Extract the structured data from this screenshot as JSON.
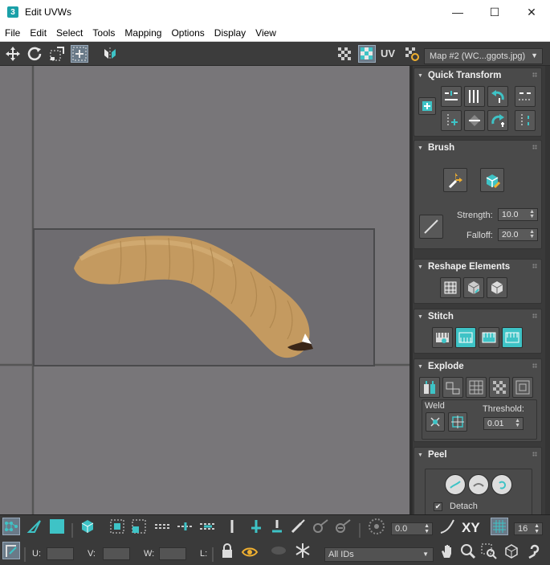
{
  "window": {
    "title": "Edit UVWs",
    "app_icon_glyph": "3",
    "minimize": "—",
    "maximize": "☐",
    "close": "✕"
  },
  "menu": [
    "File",
    "Edit",
    "Select",
    "Tools",
    "Mapping",
    "Options",
    "Display",
    "View"
  ],
  "toolbar": {
    "uv_label": "UV",
    "map_selector": "Map #2 (WC...ggots.jpg)"
  },
  "panel": {
    "quick_transform": {
      "title": "Quick Transform"
    },
    "brush": {
      "title": "Brush",
      "strength_label": "Strength:",
      "strength_value": "10.0",
      "falloff_label": "Falloff:",
      "falloff_value": "20.0"
    },
    "reshape": {
      "title": "Reshape Elements"
    },
    "stitch": {
      "title": "Stitch"
    },
    "explode": {
      "title": "Explode",
      "weld_label": "Weld",
      "threshold_label": "Threshold:",
      "threshold_value": "0.01"
    },
    "peel": {
      "title": "Peel",
      "detach_label": "Detach",
      "detach_checked": true
    }
  },
  "bottom": {
    "rotate_value": "0.0",
    "xy_label": "XY",
    "grid_value": "16",
    "u_label": "U:",
    "v_label": "V:",
    "w_label": "W:",
    "l_label": "L:",
    "ids_dropdown": "All IDs"
  },
  "colors": {
    "accent": "#3ec3c6",
    "viewport_bg": "#767477",
    "panel_bg": "#4a4a4a",
    "larva": "#c49a60"
  }
}
